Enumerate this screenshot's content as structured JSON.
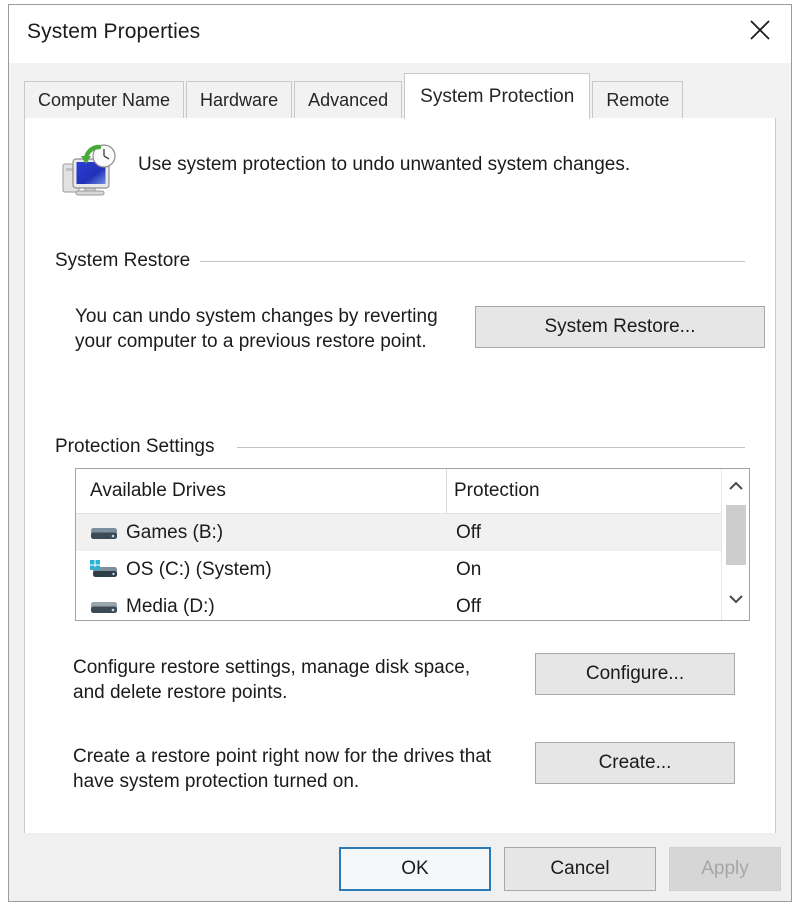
{
  "window": {
    "title": "System Properties",
    "close_icon": "close-icon"
  },
  "tabs": [
    {
      "label": "Computer Name",
      "selected": false
    },
    {
      "label": "Hardware",
      "selected": false
    },
    {
      "label": "Advanced",
      "selected": false
    },
    {
      "label": "System Protection",
      "selected": true
    },
    {
      "label": "Remote",
      "selected": false
    }
  ],
  "header": {
    "icon": "system-restore-icon",
    "description": "Use system protection to undo unwanted system changes."
  },
  "system_restore": {
    "group_label": "System Restore",
    "description_line1": "You can undo system changes by reverting",
    "description_line2": "your computer to a previous restore point.",
    "button_label": "System Restore..."
  },
  "protection_settings": {
    "group_label": "Protection Settings",
    "columns": {
      "drives": "Available Drives",
      "protection": "Protection"
    },
    "rows": [
      {
        "icon": "drive-icon",
        "name": "Games (B:)",
        "protection": "Off",
        "highlighted": true
      },
      {
        "icon": "system-drive-icon",
        "name": "OS (C:) (System)",
        "protection": "On",
        "highlighted": false
      },
      {
        "icon": "drive-icon",
        "name": "Media (D:)",
        "protection": "Off",
        "highlighted": false
      }
    ],
    "scrollbar": {
      "up_icon": "chevron-up-icon",
      "down_icon": "chevron-down-icon"
    }
  },
  "configure": {
    "description_line1": "Configure restore settings, manage disk space,",
    "description_line2": "and delete restore points.",
    "button_label": "Configure..."
  },
  "create": {
    "description_line1": "Create a restore point right now for the drives that",
    "description_line2": "have system protection turned on.",
    "button_label": "Create..."
  },
  "footer": {
    "ok_label": "OK",
    "cancel_label": "Cancel",
    "apply_label": "Apply",
    "apply_disabled": true
  },
  "colors": {
    "accent": "#2a7ab8",
    "dialog_bg": "#f0f0f0",
    "panel_bg": "#ffffff",
    "button_bg": "#e6e6e6",
    "text": "#1b1b1b",
    "disabled_text": "#a6a6a6"
  }
}
